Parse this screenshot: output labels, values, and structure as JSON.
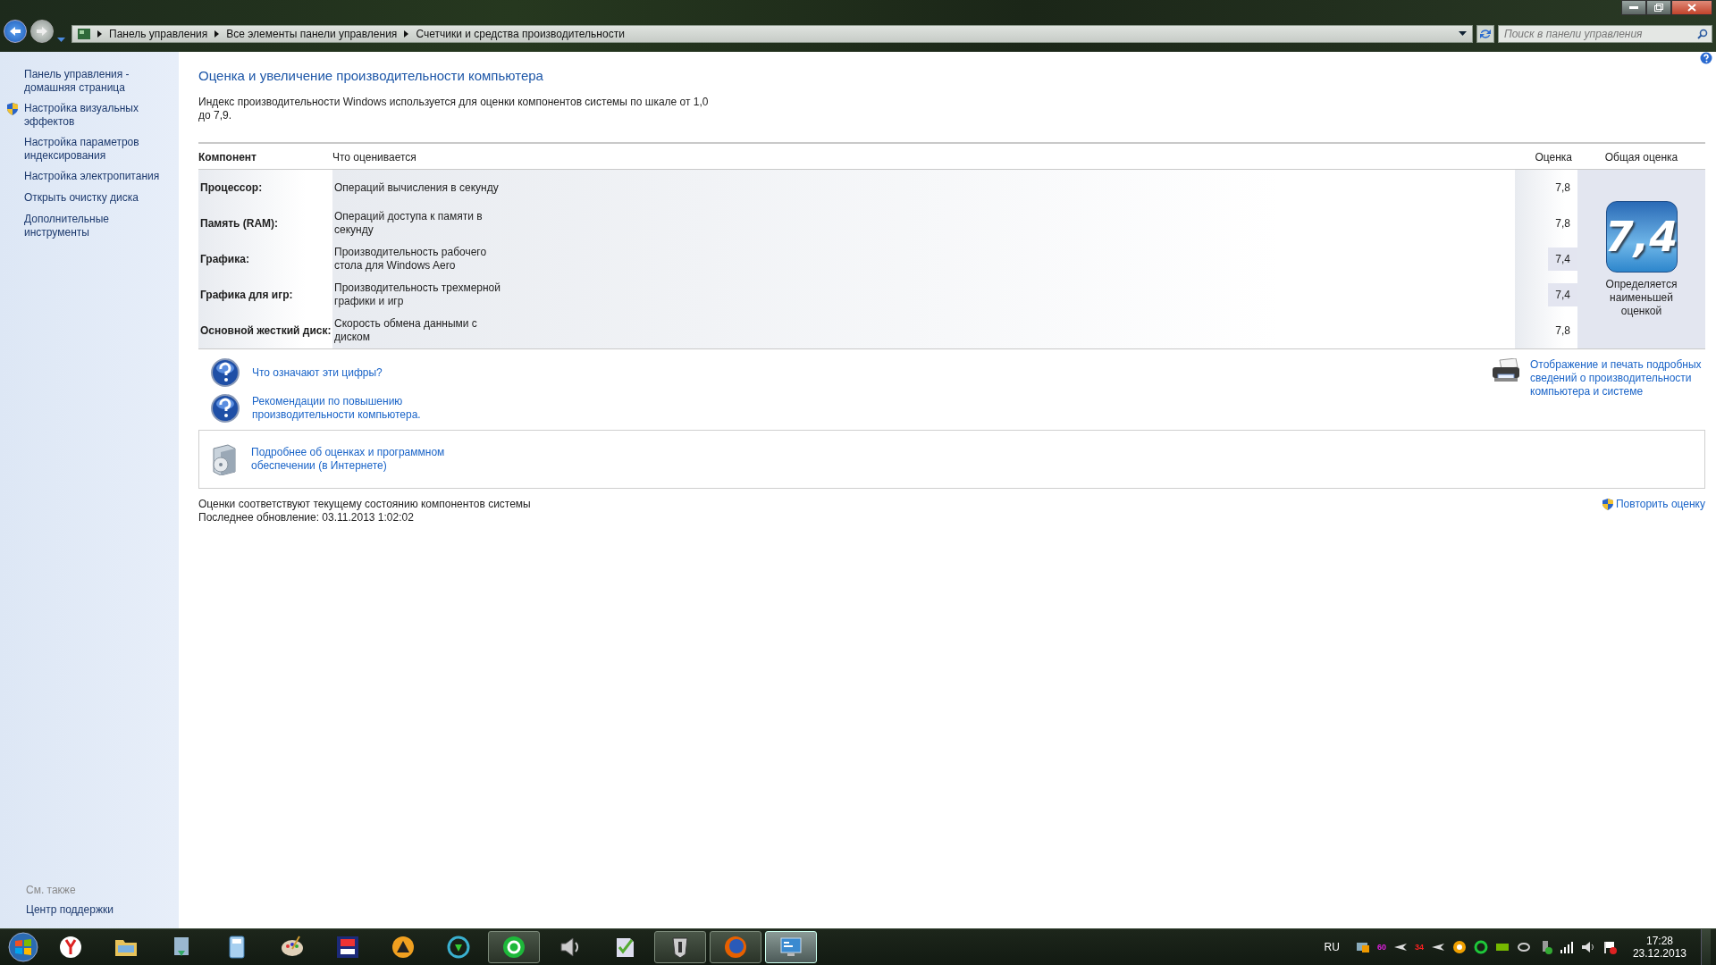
{
  "window": {
    "breadcrumbs": [
      "Панель управления",
      "Все элементы панели управления",
      "Счетчики и средства производительности"
    ],
    "search": {
      "placeholder": "Поиск в панели управления"
    }
  },
  "sidebar": {
    "items": [
      {
        "label": "Панель управления - домашняя страница",
        "shield": false
      },
      {
        "label": "Настройка визуальных эффектов",
        "shield": true
      },
      {
        "label": "Настройка параметров индексирования",
        "shield": false
      },
      {
        "label": "Настройка электропитания",
        "shield": false
      },
      {
        "label": "Открыть очистку диска",
        "shield": false
      },
      {
        "label": "Дополнительные инструменты",
        "shield": false
      }
    ],
    "see_also": {
      "heading": "См. также",
      "items": [
        "Центр поддержки"
      ]
    }
  },
  "page": {
    "title": "Оценка и увеличение производительности компьютера",
    "description": "Индекс производительности Windows используется для оценки компонентов системы по шкале от 1,0 до 7,9.",
    "table": {
      "columns": [
        "Компонент",
        "Что оценивается",
        "Оценка",
        "Общая оценка"
      ],
      "rows": [
        {
          "component": "Процессор:",
          "measure": "Операций вычисления в секунду",
          "score": "7,8",
          "lowest": false
        },
        {
          "component": "Память (RAM):",
          "measure": "Операций доступа к памяти в секунду",
          "score": "7,8",
          "lowest": false
        },
        {
          "component": "Графика:",
          "measure": "Производительность рабочего стола для Windows Aero",
          "score": "7,4",
          "lowest": true
        },
        {
          "component": "Графика для игр:",
          "measure": "Производительность трехмерной графики и игр",
          "score": "7,4",
          "lowest": true
        },
        {
          "component": "Основной жесткий диск:",
          "measure": "Скорость обмена данными с диском",
          "score": "7,8",
          "lowest": false
        }
      ],
      "overall": {
        "score": "7,4",
        "caption": "Определяется наименьшей оценкой"
      }
    },
    "help_links": [
      "Что означают эти цифры?",
      "Рекомендации по повышению производительности компьютера."
    ],
    "print_link": "Отображение и печать подробных сведений о производительности компьютера и системе",
    "online_link": "Подробнее об оценках и программном обеспечении (в Интернете)",
    "status": "Оценки соответствуют текущему состоянию компонентов системы",
    "last_update": "Последнее обновление: 03.11.2013 1:02:02",
    "rerun": "Повторить оценку"
  },
  "taskbar": {
    "apps": [
      {
        "running": false,
        "selected": false
      },
      {
        "running": false,
        "selected": false
      },
      {
        "running": false,
        "selected": false
      },
      {
        "running": false,
        "selected": false
      },
      {
        "running": false,
        "selected": false
      },
      {
        "running": false,
        "selected": false
      },
      {
        "running": false,
        "selected": false
      },
      {
        "running": false,
        "selected": false
      },
      {
        "running": true,
        "selected": false
      },
      {
        "running": false,
        "selected": false
      },
      {
        "running": false,
        "selected": false
      },
      {
        "running": true,
        "selected": false
      },
      {
        "running": true,
        "selected": false
      },
      {
        "running": true,
        "selected": true
      }
    ],
    "tray": {
      "language": "RU",
      "badges": [
        "60",
        "34"
      ],
      "time": "17:28",
      "date": "23.12.2013"
    }
  }
}
